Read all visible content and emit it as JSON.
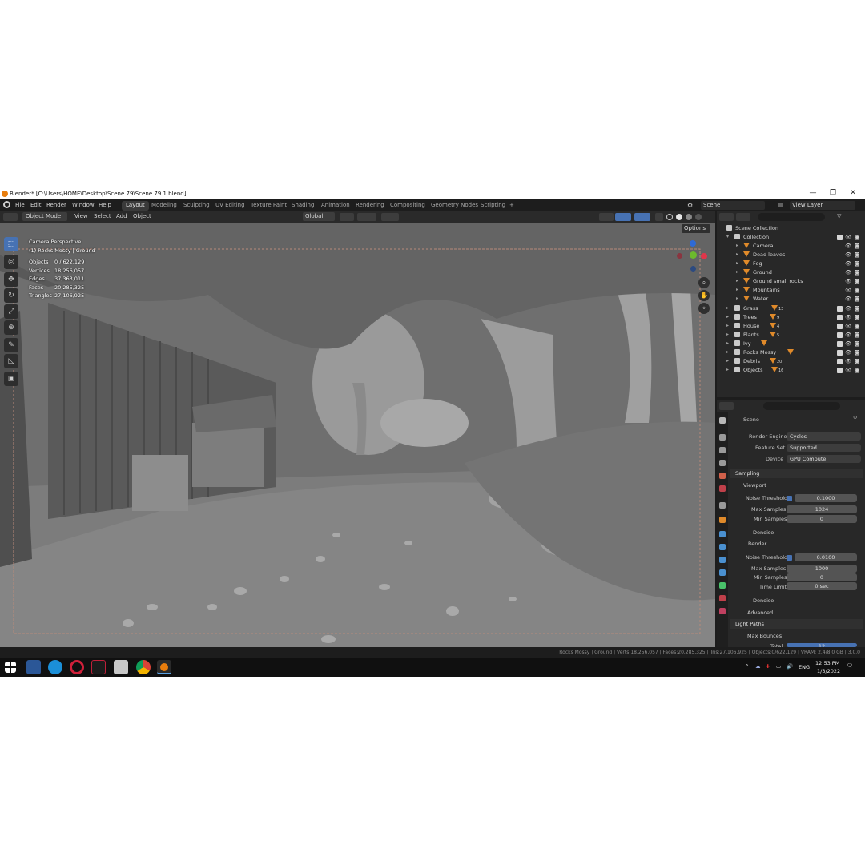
{
  "window": {
    "title": "Blender* [C:\\Users\\HOME\\Desktop\\Scene 79\\Scene 79.1.blend]",
    "minimize": "—",
    "maximize": "❐",
    "close": "✕"
  },
  "menu": [
    "File",
    "Edit",
    "Render",
    "Window",
    "Help"
  ],
  "workspaces": [
    "Layout",
    "Modeling",
    "Sculpting",
    "UV Editing",
    "Texture Paint",
    "Shading",
    "Animation",
    "Rendering",
    "Compositing",
    "Geometry Nodes",
    "Scripting",
    "+"
  ],
  "active_workspace": "Layout",
  "scene_selector": "Scene",
  "view_layer": "View Layer",
  "viewport_header": {
    "mode": "Object Mode",
    "view": "View",
    "select": "Select",
    "add": "Add",
    "object": "Object",
    "orientation": "Global",
    "options": "Options"
  },
  "overlay": {
    "line1": "Camera Perspective",
    "line2": "(1) Rocks Mossy | Ground",
    "stats": [
      {
        "k": "Objects",
        "v": "0 / 622,129"
      },
      {
        "k": "Vertices",
        "v": "18,256,057"
      },
      {
        "k": "Edges",
        "v": "37,363,011"
      },
      {
        "k": "Faces",
        "v": "20,285,325"
      },
      {
        "k": "Triangles",
        "v": "27,106,925"
      }
    ]
  },
  "outliner": {
    "root": "Scene Collection",
    "collection": "Collection",
    "children": [
      "Camera",
      "Dead leaves",
      "Fog",
      "Ground",
      "Ground small rocks",
      "Mountains",
      "Water"
    ],
    "collections": [
      "Grass",
      "Trees",
      "House",
      "Plants",
      "Ivy",
      "Rocks Mossy",
      "Debris",
      "Objects"
    ],
    "badges": {
      "Grass": "13",
      "Trees": "9",
      "House": "4",
      "Plants": "5",
      "Debris": "20",
      "Objects": "16"
    }
  },
  "properties": {
    "scene_label": "Scene",
    "render_engine_label": "Render Engine",
    "render_engine": "Cycles",
    "feature_set_label": "Feature Set",
    "feature_set": "Supported",
    "device_label": "Device",
    "device": "GPU Compute",
    "sampling": "Sampling",
    "viewport": "Viewport",
    "noise_threshold_label": "Noise Threshold",
    "vp_noise_threshold": "0.1000",
    "max_samples_label": "Max Samples",
    "vp_max_samples": "1024",
    "min_samples_label": "Min Samples",
    "vp_min_samples": "0",
    "denoise": "Denoise",
    "render": "Render",
    "r_noise_threshold": "0.0100",
    "r_max_samples": "1000",
    "r_min_samples": "0",
    "time_limit_label": "Time Limit",
    "r_time_limit": "0 sec",
    "denoise2": "Denoise",
    "advanced": "Advanced",
    "light_paths": "Light Paths",
    "max_bounces": "Max Bounces",
    "total_label": "Total",
    "total_value": "12"
  },
  "statusbar": "Rocks Mossy | Ground | Verts:18,256,057 | Faces:20,285,325 | Tris:27,106,925 | Objects:0/622,129 | VRAM: 2.4/8.0 GB | 3.0.0",
  "taskbar": {
    "language": "ENG",
    "time": "12:53 PM",
    "date": "1/3/2022"
  },
  "colors": {
    "accent": "#4772b3",
    "blender_orange": "#e87d0d",
    "object_orange": "#e08a2a",
    "mesh_green": "#49c26a"
  }
}
